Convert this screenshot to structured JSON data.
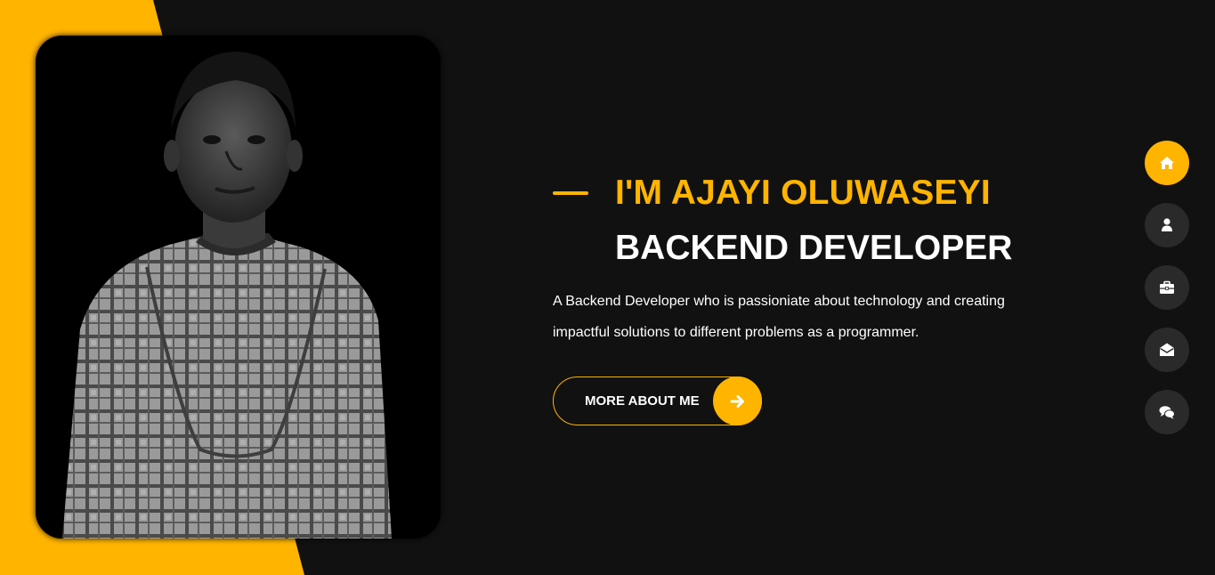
{
  "hero": {
    "name": "I'M AJAYI OLUWASEYI",
    "role": "BACKEND DEVELOPER",
    "description": "A Backend Developer who is passioniate about technology and creating impactful solutions to different problems as a programmer.",
    "button_label": "MORE ABOUT ME",
    "button_icon": "arrow-right-icon"
  },
  "nav": {
    "items": [
      {
        "icon": "home-icon",
        "active": true
      },
      {
        "icon": "user-icon",
        "active": false
      },
      {
        "icon": "briefcase-icon",
        "active": false
      },
      {
        "icon": "envelope-open-icon",
        "active": false
      },
      {
        "icon": "comments-icon",
        "active": false
      }
    ]
  },
  "colors": {
    "accent": "#ffb400",
    "background": "#111111",
    "nav_inactive": "#2b2a2a",
    "text": "#ffffff"
  }
}
